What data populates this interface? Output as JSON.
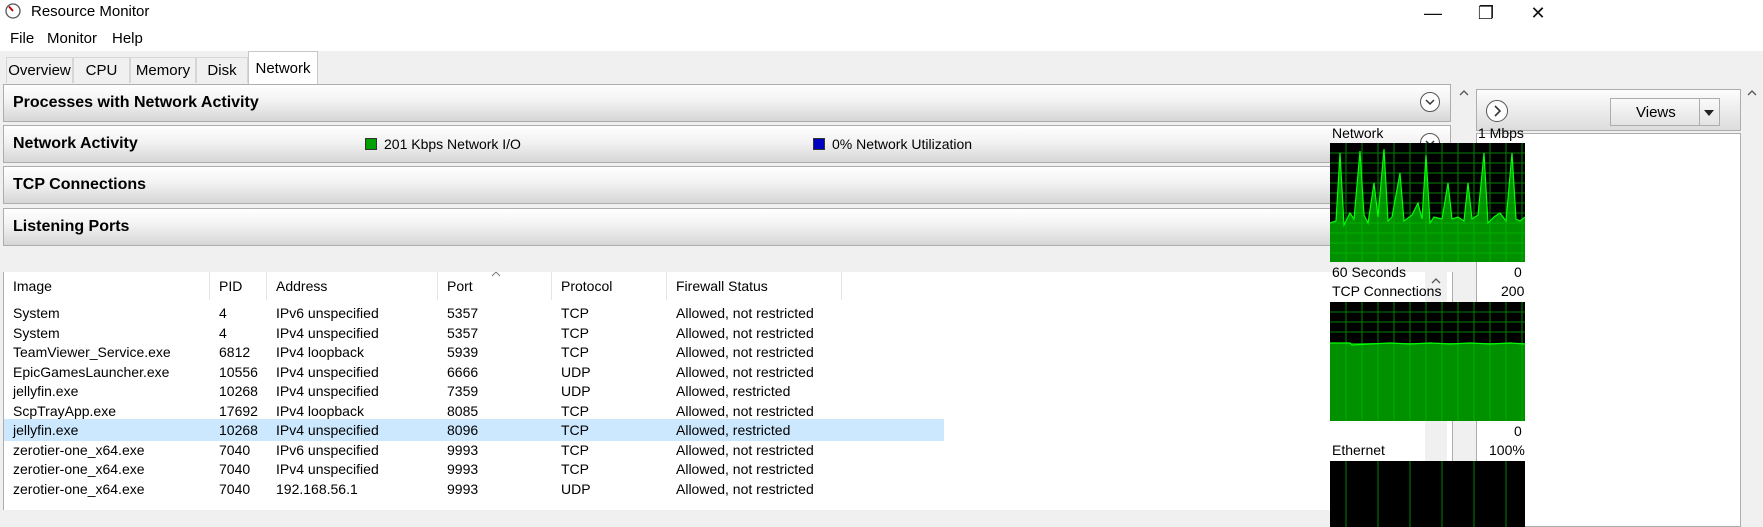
{
  "window": {
    "title": "Resource Monitor",
    "minimize": "—",
    "restore": "❐",
    "close": "✕"
  },
  "menu": [
    "File",
    "Monitor",
    "Help"
  ],
  "tabs": [
    "Overview",
    "CPU",
    "Memory",
    "Disk",
    "Network"
  ],
  "active_tab": "Network",
  "sections": {
    "processes": "Processes with Network Activity",
    "activity": "Network Activity",
    "activity_io": "201 Kbps Network I/O",
    "activity_util": "0% Network Utilization",
    "tcp": "TCP Connections",
    "listening": "Listening Ports"
  },
  "colors": {
    "io_green": "#00a000",
    "util_blue": "#0000c0",
    "graph_green": "#00ff00",
    "selected_row": "#cce8ff"
  },
  "table": {
    "columns": [
      "Image",
      "PID",
      "Address",
      "Port",
      "Protocol",
      "Firewall Status"
    ],
    "rows": [
      [
        "System",
        "4",
        "IPv6 unspecified",
        "5357",
        "TCP",
        "Allowed, not restricted"
      ],
      [
        "System",
        "4",
        "IPv4 unspecified",
        "5357",
        "TCP",
        "Allowed, not restricted"
      ],
      [
        "TeamViewer_Service.exe",
        "6812",
        "IPv4 loopback",
        "5939",
        "TCP",
        "Allowed, not restricted"
      ],
      [
        "EpicGamesLauncher.exe",
        "10556",
        "IPv4 unspecified",
        "6666",
        "UDP",
        "Allowed, not restricted"
      ],
      [
        "jellyfin.exe",
        "10268",
        "IPv4 unspecified",
        "7359",
        "UDP",
        "Allowed, restricted"
      ],
      [
        "ScpTrayApp.exe",
        "17692",
        "IPv4 loopback",
        "8085",
        "TCP",
        "Allowed, not restricted"
      ],
      [
        "jellyfin.exe",
        "10268",
        "IPv4 unspecified",
        "8096",
        "TCP",
        "Allowed, restricted"
      ],
      [
        "zerotier-one_x64.exe",
        "7040",
        "IPv6 unspecified",
        "9993",
        "TCP",
        "Allowed, not restricted"
      ],
      [
        "zerotier-one_x64.exe",
        "7040",
        "IPv4 unspecified",
        "9993",
        "TCP",
        "Allowed, not restricted"
      ],
      [
        "zerotier-one_x64.exe",
        "7040",
        "192.168.56.1",
        "9993",
        "UDP",
        "Allowed, not restricted"
      ]
    ],
    "selected_index": 6
  },
  "right": {
    "views": "Views",
    "network_label": "Network",
    "network_max": "1 Mbps",
    "network_x": "60 Seconds",
    "network_min": "0",
    "tcp_label": "TCP Connections",
    "tcp_max": "200",
    "tcp_min": "0",
    "eth_label": "Ethernet",
    "eth_max": "100%"
  }
}
